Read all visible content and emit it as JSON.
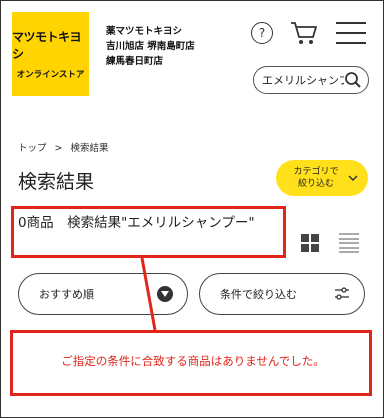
{
  "header": {
    "logo_main": "マツモトキヨシ",
    "logo_sub": "オンラインストア",
    "store_lines": [
      "薬マツモトキヨシ",
      "吉川旭店 堺南島町店",
      "練馬春日町店"
    ],
    "help_symbol": "?",
    "icons": {
      "help": "help-icon",
      "cart": "cart-icon",
      "menu": "hamburger-menu-icon",
      "search": "search-icon"
    }
  },
  "search": {
    "value": "エメリルシャンプー"
  },
  "breadcrumb": {
    "home": "トップ",
    "separator": ">",
    "current": "検索結果"
  },
  "page_title": "検索結果",
  "category_button": {
    "label_line1": "カテゴリで",
    "label_line2": "絞り込む"
  },
  "results": {
    "summary": "0商品　検索結果\"エメリルシャンプー\""
  },
  "sort": {
    "selected": "おすすめ順"
  },
  "filter": {
    "label": "条件で絞り込む"
  },
  "message": "ご指定の条件に合致する商品はありませんでした。",
  "colors": {
    "brand_yellow": "#ffd400",
    "button_yellow": "#ffe01b",
    "annotation_red": "#e0251b"
  }
}
